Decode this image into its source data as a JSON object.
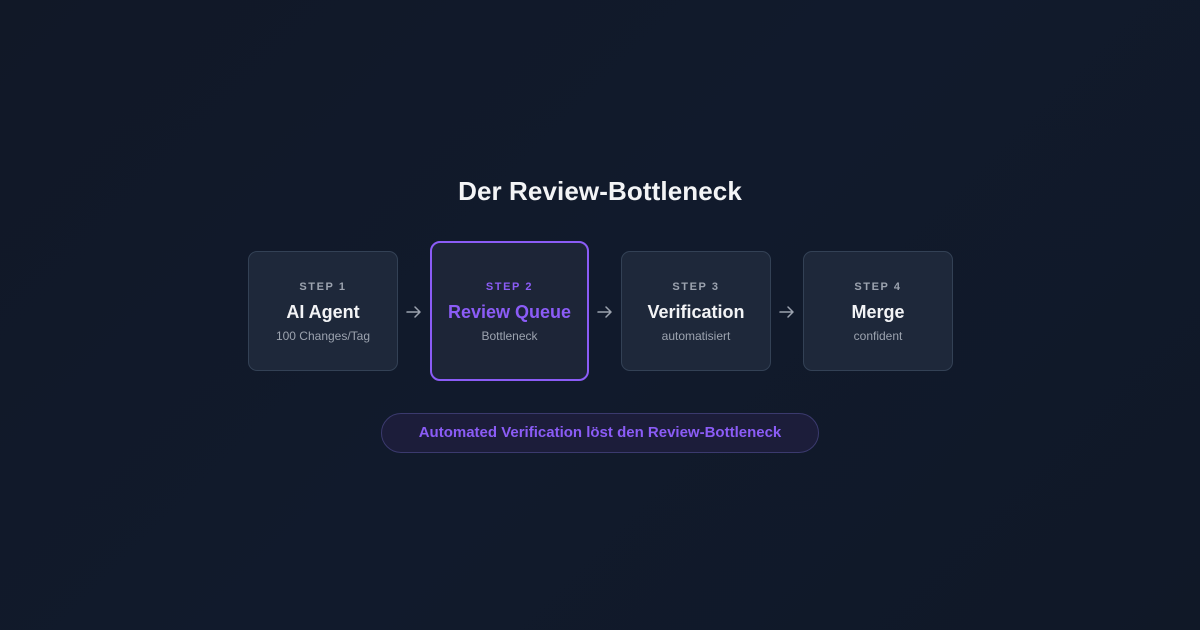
{
  "title": "Der Review-Bottleneck",
  "steps": [
    {
      "label": "STEP 1",
      "name": "AI Agent",
      "sub": "100 Changes/Tag"
    },
    {
      "label": "STEP 2",
      "name": "Review Queue",
      "sub": "Bottleneck"
    },
    {
      "label": "STEP 3",
      "name": "Verification",
      "sub": "automatisiert"
    },
    {
      "label": "STEP 4",
      "name": "Merge",
      "sub": "confident"
    }
  ],
  "banner": "Automated Verification löst den Review-Bottleneck",
  "colors": {
    "accent": "#8b5cf6",
    "background": "#111827",
    "card": "#1e283a",
    "card_border": "#334155",
    "text": "#f3f4f6",
    "muted": "#9ca3af"
  },
  "icons": [
    "arrow-right-icon"
  ]
}
